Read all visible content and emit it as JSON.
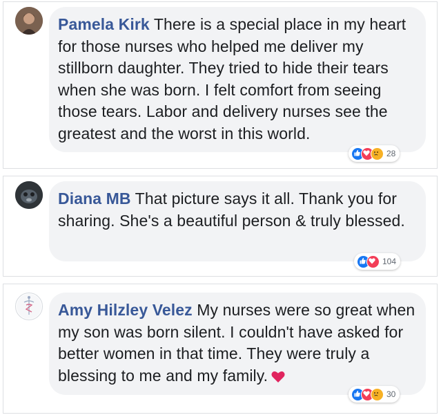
{
  "comments": [
    {
      "author": "Pamela Kirk",
      "text": "There is a special place in my heart for those nurses who helped me deliver my stillborn daughter. They tried to hide their tears when she was born. I felt comfort from seeing those tears. Labor and delivery nurses see the greatest and the worst in this world.",
      "reactions": [
        "like-icon",
        "love-icon",
        "sad-icon"
      ],
      "reaction_count": "28"
    },
    {
      "author": "Diana MB",
      "text": "That picture says it all. Thank you for sharing. She's a beautiful person & truly blessed.",
      "reactions": [
        "like-icon",
        "love-icon"
      ],
      "reaction_count": "104"
    },
    {
      "author": "Amy Hilzley Velez",
      "text": "My nurses were so great when my son was born silent. I couldn't have asked for better women in that time. They were truly a blessing to me and my family.",
      "trailing_emoji": "heart-emoji-icon",
      "reactions": [
        "like-icon",
        "love-icon",
        "sad-icon"
      ],
      "reaction_count": "30"
    }
  ],
  "colors": {
    "author_name": "#385898",
    "bubble_background": "#f2f3f5",
    "like": "#1877f2",
    "love": "#f33e58",
    "sad": "#f7b125",
    "heart_emoji": "#e0245e"
  }
}
